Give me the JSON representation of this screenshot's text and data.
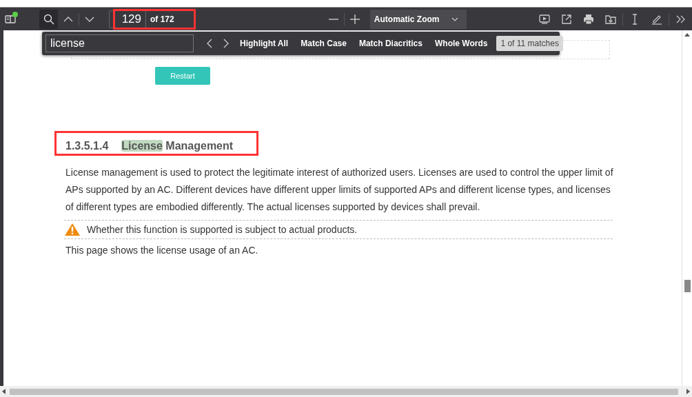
{
  "toolbar": {
    "sidebar_notification": true,
    "search_active": true,
    "page_number": "129",
    "page_count": "of 172",
    "zoom": "Automatic Zoom"
  },
  "find_bar": {
    "query": "license",
    "options": [
      {
        "label": "Highlight All",
        "selected": false
      },
      {
        "label": "Match Case",
        "selected": false
      },
      {
        "label": "Match Diacritics",
        "selected": false
      },
      {
        "label": "Whole Words",
        "selected": false
      }
    ],
    "result": "1 of 11 matches"
  },
  "document": {
    "button": "Restart",
    "heading": {
      "number": "1.3.5.1.4",
      "parts": [
        {
          "text": "License",
          "highlighted": true
        },
        {
          "text": " Management",
          "highlighted": false
        }
      ]
    },
    "paragraph": "License management is used to protect the legitimate interest of authorized users. Licenses are used to control the upper limit of APs supported by an AC. Different devices have different upper limits of supported APs and different license types, and licenses of different types are embodied differently. The actual licenses supported by devices shall prevail.",
    "note": "Whether this function is supported is subject to actual products.",
    "closing": "This page shows the license usage of an AC."
  }
}
